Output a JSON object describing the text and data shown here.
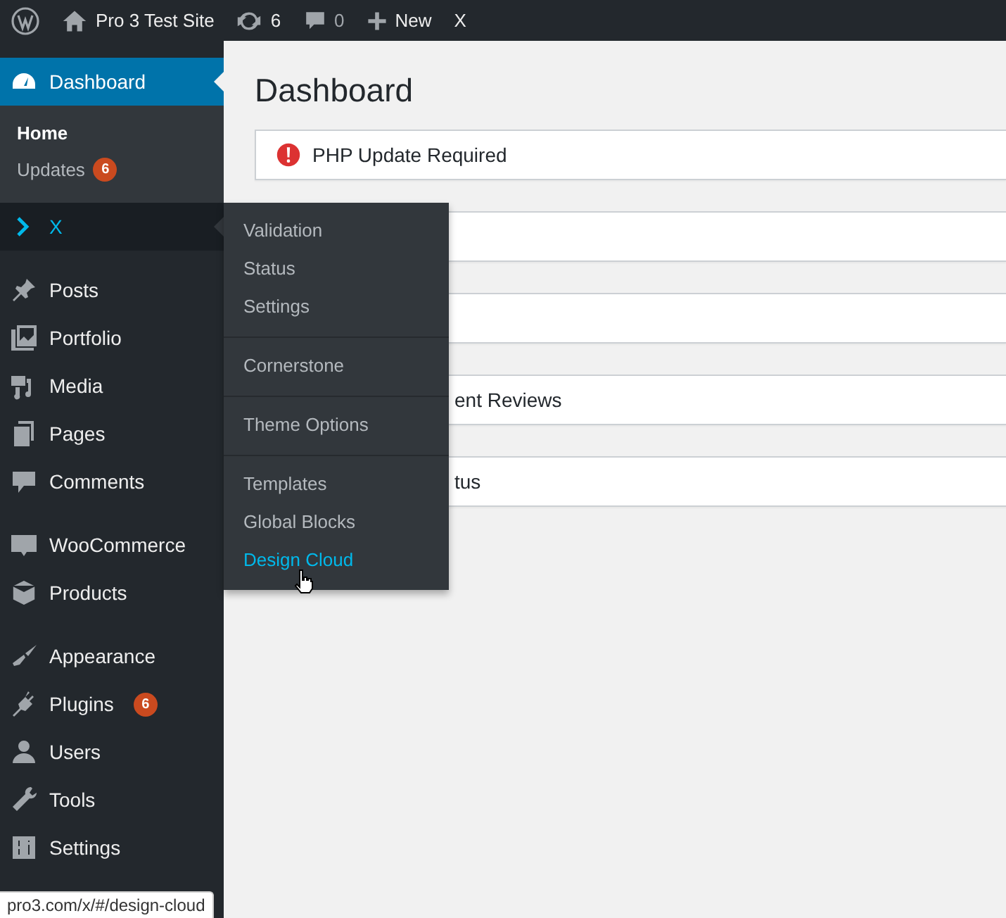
{
  "admin_bar": {
    "site_name": "Pro 3 Test Site",
    "updates_count": "6",
    "comments_count": "0",
    "new_label": "New",
    "x_label": "X"
  },
  "sidebar": {
    "groups": [
      [
        {
          "label": "Dashboard",
          "selected": true,
          "expanded": false,
          "submenu": [
            {
              "label": "Home",
              "selected": true
            },
            {
              "label": "Updates",
              "selected": false,
              "badge": "6"
            }
          ]
        },
        {
          "label": "X",
          "selected": false,
          "expanded": true,
          "flyout": [
            [
              {
                "label": "Validation",
                "hovered": false
              },
              {
                "label": "Status",
                "hovered": false
              },
              {
                "label": "Settings",
                "hovered": false
              }
            ],
            [
              {
                "label": "Cornerstone",
                "hovered": false
              }
            ],
            [
              {
                "label": "Theme Options",
                "hovered": false
              }
            ],
            [
              {
                "label": "Templates",
                "hovered": false
              },
              {
                "label": "Global Blocks",
                "hovered": false
              },
              {
                "label": "Design Cloud",
                "hovered": true
              }
            ]
          ]
        }
      ],
      [
        {
          "label": "Posts",
          "selected": false,
          "expanded": false
        },
        {
          "label": "Portfolio",
          "selected": false,
          "expanded": false
        },
        {
          "label": "Media",
          "selected": false,
          "expanded": false
        },
        {
          "label": "Pages",
          "selected": false,
          "expanded": false
        },
        {
          "label": "Comments",
          "selected": false,
          "expanded": false
        }
      ],
      [
        {
          "label": "WooCommerce",
          "selected": false,
          "expanded": false
        },
        {
          "label": "Products",
          "selected": false,
          "expanded": false
        }
      ],
      [
        {
          "label": "Appearance",
          "selected": false,
          "expanded": false
        },
        {
          "label": "Plugins",
          "selected": false,
          "expanded": false,
          "badge": "6"
        },
        {
          "label": "Users",
          "selected": false,
          "expanded": false
        },
        {
          "label": "Tools",
          "selected": false,
          "expanded": false
        },
        {
          "label": "Settings",
          "selected": false,
          "expanded": false
        }
      ]
    ]
  },
  "main": {
    "title": "Dashboard",
    "panels": [
      {
        "kind": "notice",
        "title": "PHP Update Required"
      },
      {
        "kind": "box"
      },
      {
        "kind": "box"
      },
      {
        "kind": "box",
        "title": "ent Reviews"
      },
      {
        "kind": "box",
        "title": "tus"
      }
    ]
  },
  "status_bar": "pro3.com/x/#/design-cloud"
}
